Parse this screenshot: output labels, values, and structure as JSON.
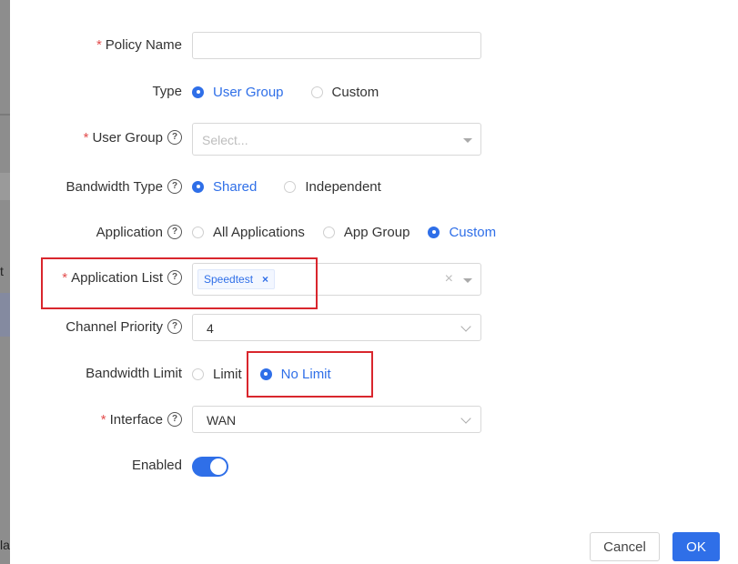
{
  "background": {
    "fragments": [
      "t",
      "la"
    ]
  },
  "form": {
    "policy_name": {
      "label": "Policy Name",
      "required": "*",
      "value": ""
    },
    "type": {
      "label": "Type",
      "options": [
        "User Group",
        "Custom"
      ],
      "selected": "User Group"
    },
    "user_group": {
      "label": "User Group",
      "required": "*",
      "help": "?",
      "placeholder": "Select..."
    },
    "bandwidth_type": {
      "label": "Bandwidth Type",
      "help": "?",
      "options": [
        "Shared",
        "Independent"
      ],
      "selected": "Shared"
    },
    "application": {
      "label": "Application",
      "help": "?",
      "options": [
        "All Applications",
        "App Group",
        "Custom"
      ],
      "selected": "Custom"
    },
    "application_list": {
      "label": "Application List",
      "required": "*",
      "help": "?",
      "tags": [
        "Speedtest"
      ],
      "tag_close": "×",
      "clear": "×"
    },
    "channel_priority": {
      "label": "Channel Priority",
      "help": "?",
      "value": "4"
    },
    "bandwidth_limit": {
      "label": "Bandwidth Limit",
      "options": [
        "Limit",
        "No Limit"
      ],
      "selected": "No Limit"
    },
    "interface": {
      "label": "Interface",
      "required": "*",
      "help": "?",
      "value": "WAN"
    },
    "enabled": {
      "label": "Enabled",
      "state": "on"
    }
  },
  "footer": {
    "cancel": "Cancel",
    "ok": "OK"
  },
  "colors": {
    "primary": "#2f6fe8",
    "required": "#e34d4d",
    "highlight": "#d9262d"
  }
}
